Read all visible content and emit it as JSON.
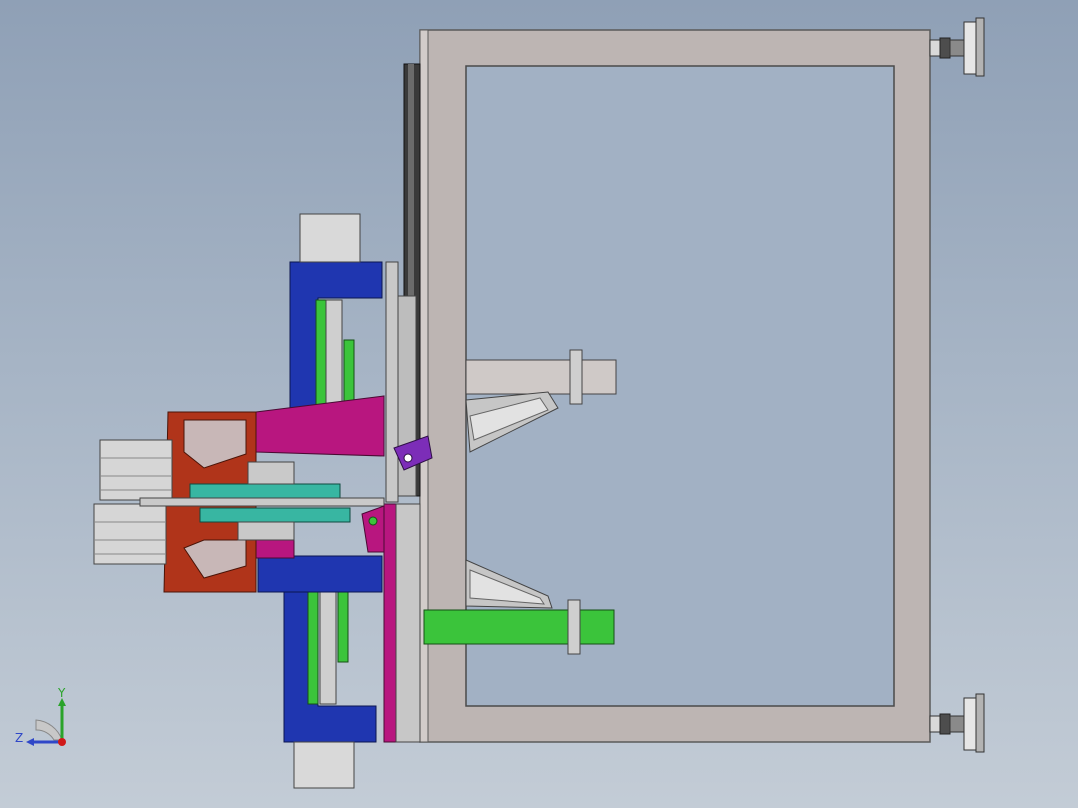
{
  "scene": {
    "background_top": "#8fa0b6",
    "background_bottom": "#c3ccd6"
  },
  "colors": {
    "frame": "#bdb5b3",
    "blue": "#1f36b0",
    "magenta": "#b8167f",
    "rust": "#b0341a",
    "green": "#3bc43b",
    "teal": "#38b6a2",
    "purple": "#7c2db8",
    "gray_part": "#c9c9c9"
  },
  "triad": {
    "y_label": "Y",
    "z_label": "Z",
    "y_color": "#2aa32a",
    "z_color": "#2f47c8",
    "x_color": "#d01919",
    "icons": [
      "axis-triad-icon"
    ]
  }
}
